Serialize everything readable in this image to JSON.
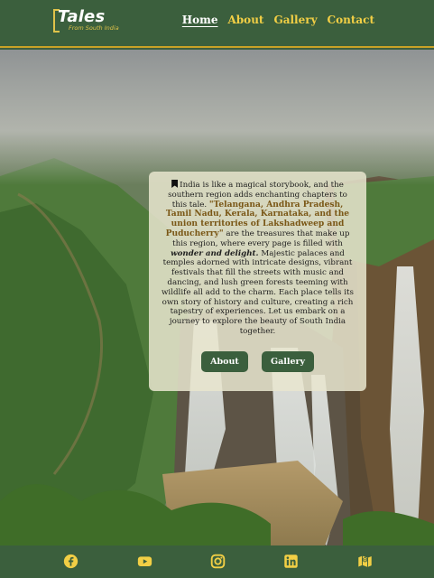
{
  "brand": {
    "title": "Tales",
    "subtitle": "From South India"
  },
  "nav": {
    "items": [
      "Home",
      "About",
      "Gallery",
      "Contact"
    ],
    "active": "Home"
  },
  "card": {
    "intro": "India is like a magical storybook, and the southern region adds enchanting chapters to this tale.",
    "states": "\"Telangana, Andhra Pradesh, Tamil Nadu, Kerala, Karnataka, and the union territories of Lakshadweep and Puducherry\"",
    "middle": "are the treasures that make up this region, where every page is filled with",
    "emphasis": "wonder and delight.",
    "rest": "Majestic palaces and temples adorned with intricate designs, vibrant festivals that fill the streets with music and dancing, and lush green forests teeming with wildlife all add to the charm. Each place tells its own story of history and culture, creating a rich tapestry of experiences. Let us embark on a journey to explore the beauty of South India together.",
    "buttons": {
      "about": "About",
      "gallery": "Gallery"
    }
  },
  "footer": {
    "icons": [
      "facebook-icon",
      "youtube-icon",
      "instagram-icon",
      "linkedin-icon",
      "map-icon"
    ]
  },
  "colors": {
    "primary_green": "#3b5f3d",
    "accent_gold": "#f2cf45",
    "highlight_brown": "#7a5716"
  }
}
